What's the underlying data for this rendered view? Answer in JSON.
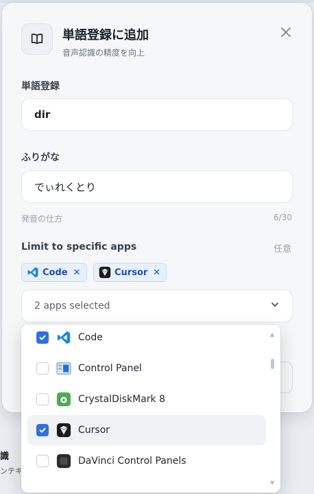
{
  "dialog": {
    "title": "単語登録に追加",
    "subtitle": "音声認識の精度を向上",
    "word_label": "単語登録",
    "word_value": "dir",
    "furigana_label": "ふりがな",
    "furigana_value": "でぃれくとり",
    "pronunciation_hint": "発音の仕方",
    "char_count": "6/30",
    "apps_label": "Limit to specific apps",
    "apps_optional": "任意",
    "selected_chips": [
      {
        "label": "Code"
      },
      {
        "label": "Cursor"
      }
    ],
    "select_value": "2 apps selected"
  },
  "app_options": [
    {
      "label": "Code",
      "checked": true,
      "icon": "vscode-icon"
    },
    {
      "label": "Control Panel",
      "checked": false,
      "icon": "control-panel-icon"
    },
    {
      "label": "CrystalDiskMark 8",
      "checked": false,
      "icon": "crystaldiskmark-icon"
    },
    {
      "label": "Cursor",
      "checked": true,
      "icon": "cursor-app-icon"
    },
    {
      "label": "DaVinci Control Panels",
      "checked": false,
      "icon": "davinci-icon"
    }
  ],
  "background": {
    "fragment1": "識",
    "fragment2": "ンテキス"
  },
  "colors": {
    "accent": "#2f6fe0",
    "chip_bg": "#e8f0fd",
    "chip_text": "#1f4fb5"
  }
}
